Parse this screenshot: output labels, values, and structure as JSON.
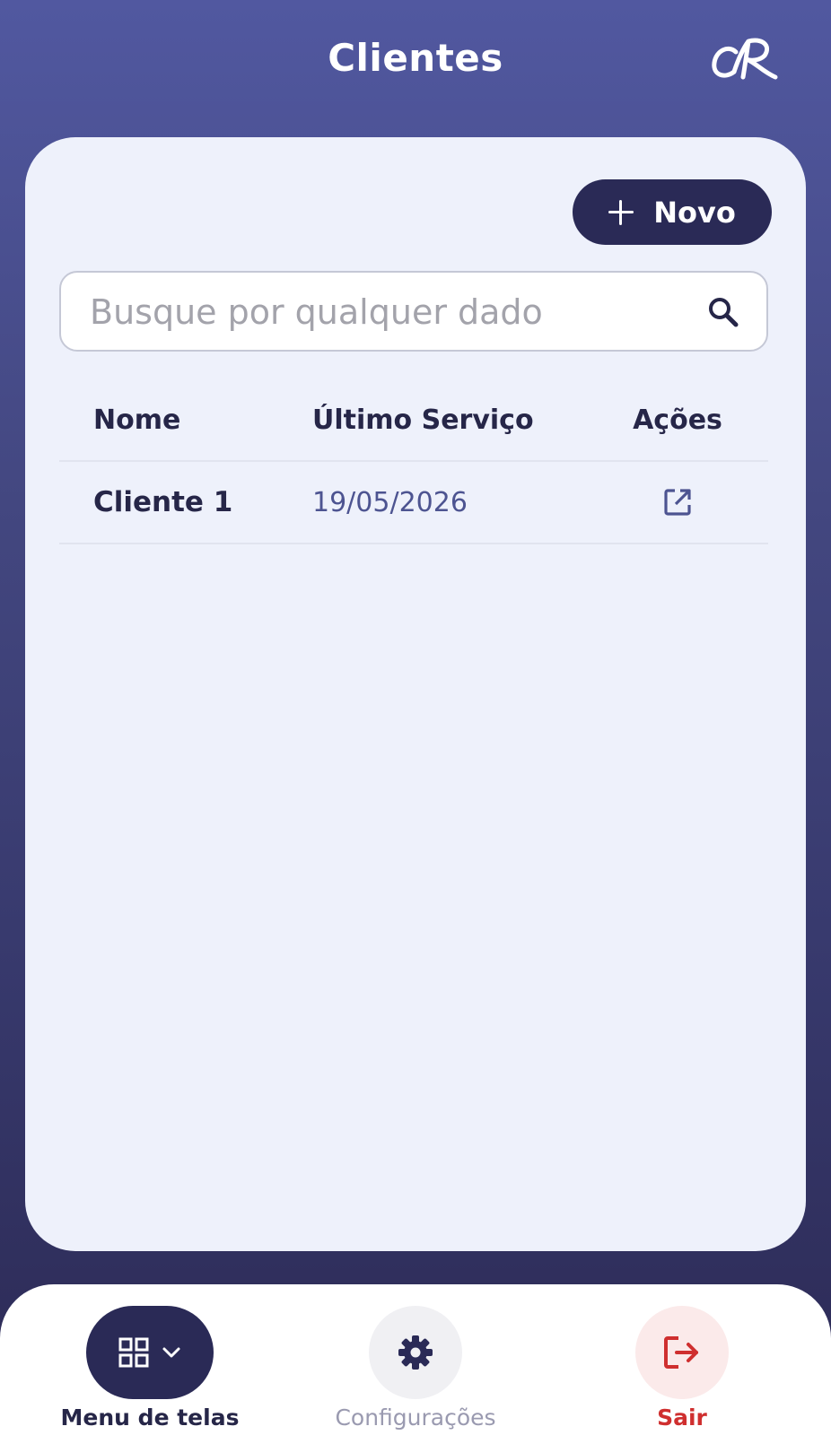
{
  "header": {
    "title": "Clientes",
    "logo_icon": "cr-monogram-logo"
  },
  "actions": {
    "new_label": "Novo",
    "new_icon": "plus-icon"
  },
  "search": {
    "placeholder": "Busque por qualquer dado",
    "value": "",
    "icon": "search-icon"
  },
  "table": {
    "columns": [
      "Nome",
      "Último Serviço",
      "Ações"
    ],
    "rows": [
      {
        "name": "Cliente 1",
        "last_service": "19/05/2026",
        "action_icon": "external-link-icon"
      }
    ]
  },
  "bottom_nav": {
    "items": [
      {
        "label": "Menu de telas",
        "icon": "grid-icon",
        "secondary_icon": "chevron-down-icon",
        "active": true
      },
      {
        "label": "Configurações",
        "icon": "gear-icon",
        "active": false
      },
      {
        "label": "Sair",
        "icon": "logout-icon",
        "active": false
      }
    ]
  },
  "colors": {
    "primary": "#2a2a56",
    "background_top": "#5158a0",
    "background_bottom": "#2c2a55",
    "card": "#eef1fb",
    "date_text": "#4d5491",
    "danger": "#cf2f2f"
  }
}
